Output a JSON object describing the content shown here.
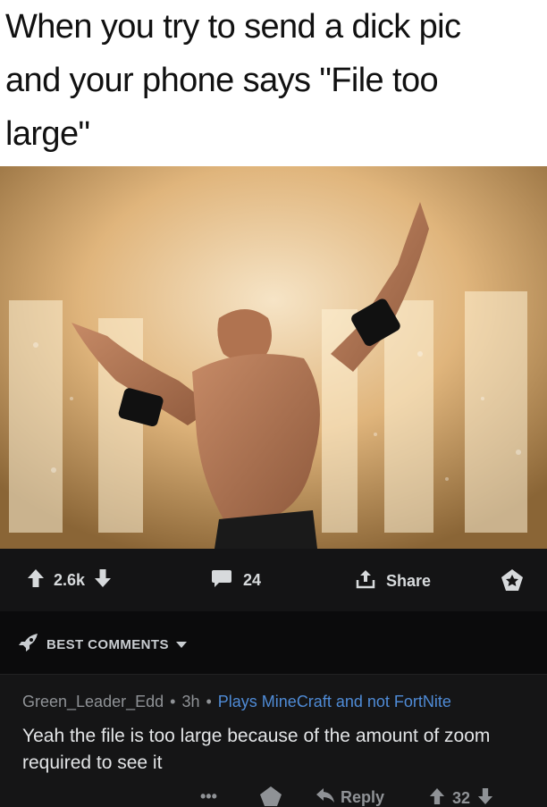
{
  "meme": {
    "caption": "When you try to send a dick pic\nand your phone says \"File too\nlarge\""
  },
  "post_actions": {
    "score": "2.6k",
    "comments": "24",
    "share_label": "Share"
  },
  "comments_sort": {
    "label": "BEST COMMENTS"
  },
  "comment": {
    "author": "Green_Leader_Edd",
    "age": "3h",
    "flair": "Plays MineCraft and not FortNite",
    "text": "Yeah the file is too large because of the amount of zoom required to see it",
    "more_label": "•••",
    "reply_label": "Reply",
    "score": "32"
  },
  "colors": {
    "background": "#0b0b0c",
    "bar": "#141415",
    "flair": "#4f8bd6",
    "text": "#d7dadc",
    "muted": "#8f9296"
  },
  "icons": [
    "upvote-icon",
    "downvote-icon",
    "comment-icon",
    "share-icon",
    "award-icon",
    "rocket-icon",
    "chevron-down-icon",
    "more-icon",
    "reply-icon"
  ]
}
